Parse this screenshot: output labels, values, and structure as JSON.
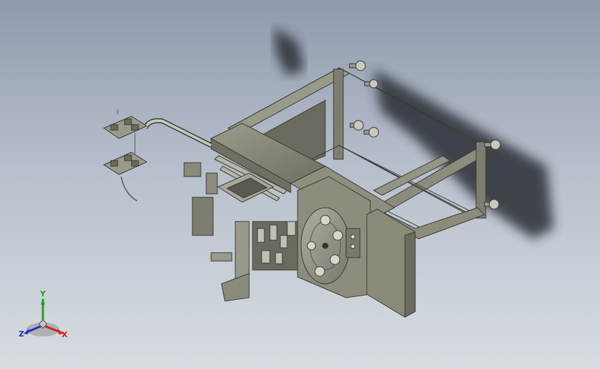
{
  "viewport": {
    "background_top": "#8e9aad",
    "background_bottom": "#d9dde2"
  },
  "model": {
    "frame_color": "#8a8a7a",
    "frame_edge_color": "#3a3a34",
    "shadow_color": "#2a2e36"
  },
  "triad": {
    "x_label": "X",
    "y_label": "Y",
    "z_label": "Z",
    "x_color": "#d22020",
    "y_color": "#20a020",
    "z_color": "#2030c0"
  }
}
